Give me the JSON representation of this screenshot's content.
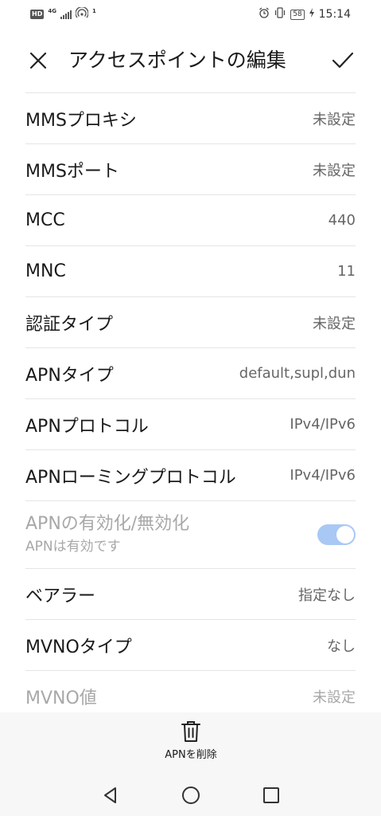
{
  "status_bar": {
    "hd": "HD",
    "network": "4G",
    "notification_count": "1",
    "battery": "58",
    "time": "15:14"
  },
  "header": {
    "title": "アクセスポイントの編集",
    "close_icon": "close-icon",
    "confirm_icon": "check-icon"
  },
  "rows": [
    {
      "label": "MMSプロキシ",
      "value": "未設定"
    },
    {
      "label": "MMSポート",
      "value": "未設定"
    },
    {
      "label": "MCC",
      "value": "440"
    },
    {
      "label": "MNC",
      "value": "11"
    },
    {
      "label": "認証タイプ",
      "value": "未設定"
    },
    {
      "label": "APNタイプ",
      "value": "default,supl,dun"
    },
    {
      "label": "APNプロトコル",
      "value": "IPv4/IPv6"
    },
    {
      "label": "APNローミングプロトコル",
      "value": "IPv4/IPv6"
    }
  ],
  "apn_toggle": {
    "title": "APNの有効化/無効化",
    "subtitle": "APNは有効です",
    "enabled": true
  },
  "rows2": [
    {
      "label": "ベアラー",
      "value": "指定なし"
    },
    {
      "label": "MVNOタイプ",
      "value": "なし"
    },
    {
      "label": "MVNO値",
      "value": "未設定"
    }
  ],
  "bottom": {
    "delete_label": "APNを削除",
    "delete_icon": "trash-icon"
  },
  "nav": {
    "back_icon": "back-triangle-icon",
    "home_icon": "home-circle-icon",
    "recents_icon": "recents-square-icon"
  },
  "colors": {
    "toggle_track": "#a9c8f4",
    "divider": "#e4e4e4",
    "disabled_text": "#a8a8a8"
  }
}
